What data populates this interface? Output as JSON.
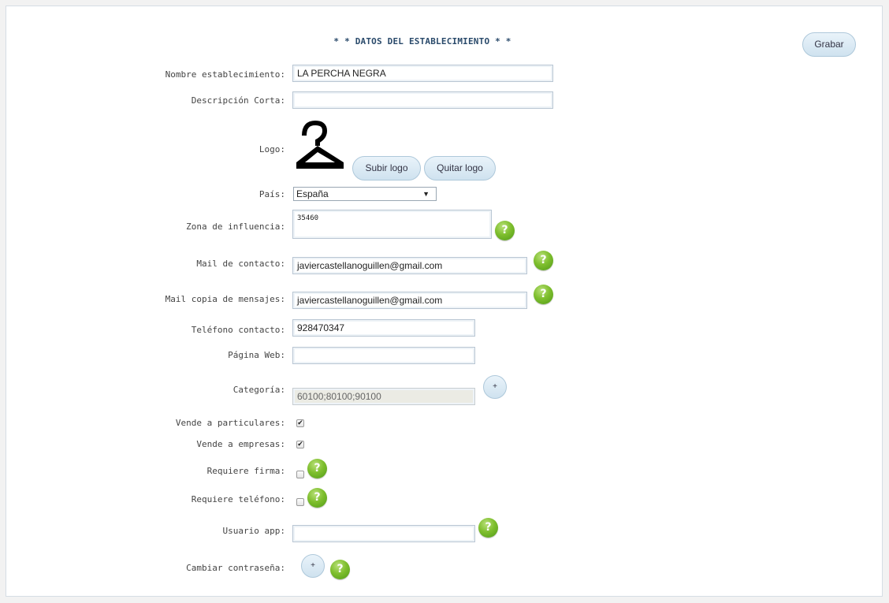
{
  "form": {
    "title": "* * DATOS DEL ESTABLECIMIENTO * *",
    "save_label": "Grabar",
    "fields": {
      "nombre": {
        "label": "Nombre establecimiento:",
        "value": "LA PERCHA NEGRA"
      },
      "descripcion": {
        "label": "Descripción Corta:",
        "value": ""
      },
      "logo": {
        "label": "Logo:",
        "upload_label": "Subir logo",
        "remove_label": "Quitar logo"
      },
      "pais": {
        "label": "País:",
        "selected": "España"
      },
      "zona": {
        "label": "Zona de influencia:",
        "value": "35460"
      },
      "mail_contacto": {
        "label": "Mail de contacto:",
        "value": "javiercastellanoguillen@gmail.com"
      },
      "mail_copia": {
        "label": "Mail copia de mensajes:",
        "value": "javiercastellanoguillen@gmail.com"
      },
      "telefono": {
        "label": "Teléfono contacto:",
        "value": "928470347"
      },
      "web": {
        "label": "Página Web:",
        "value": ""
      },
      "categoria": {
        "label": "Categoría:",
        "value": "60100;80100;90100",
        "add_label": "+"
      },
      "particulares": {
        "label": "Vende a particulares:",
        "checked": true
      },
      "empresas": {
        "label": "Vende a empresas:",
        "checked": true
      },
      "firma": {
        "label": "Requiere firma:",
        "checked": false
      },
      "req_telefono": {
        "label": "Requiere teléfono:",
        "checked": false
      },
      "usuario_app": {
        "label": "Usuario app:",
        "value": ""
      },
      "contrasena": {
        "label": "Cambiar contraseña:",
        "add_label": "+"
      }
    },
    "help_glyph": "?",
    "check_glyph": "✔",
    "icons": {
      "help": "help-icon",
      "logo": "hanger-icon"
    },
    "colors": {
      "help_green": "#6fb325",
      "button_blue": "#d6e8f4",
      "title_navy": "#2a4a6b"
    }
  }
}
